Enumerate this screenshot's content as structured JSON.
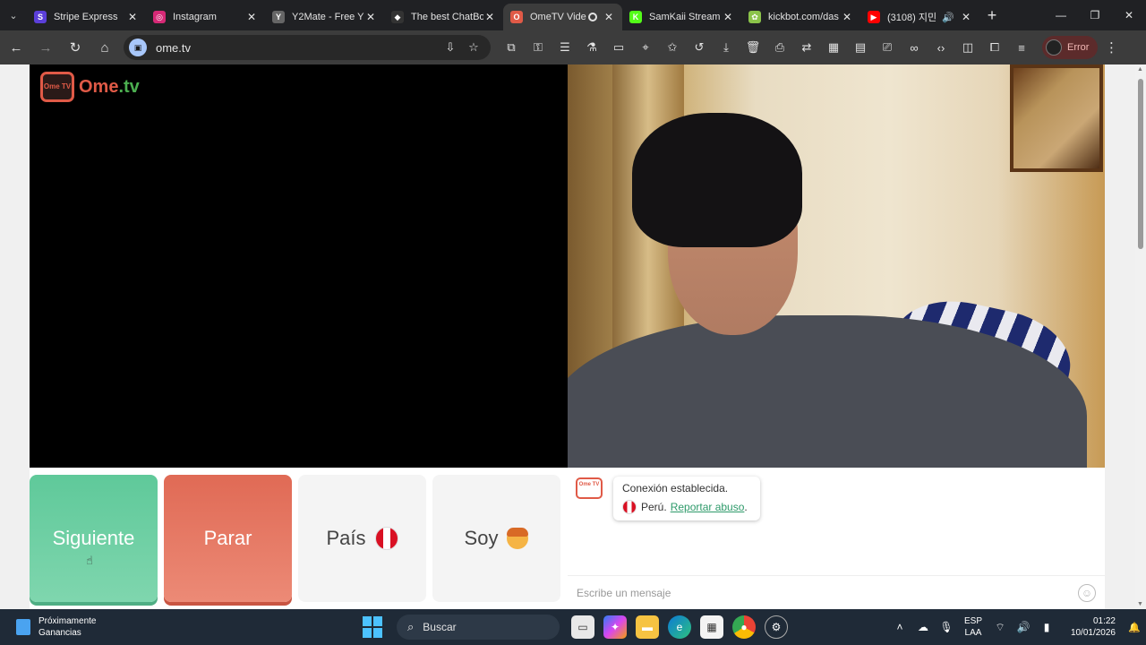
{
  "browser": {
    "tabs": [
      {
        "title": "Stripe Express",
        "fav_color": "#5b3fd9",
        "fav_glyph": "S"
      },
      {
        "title": "Instagram",
        "fav_color": "#d62976",
        "fav_glyph": "◎"
      },
      {
        "title": "Y2Mate - Free Y",
        "fav_color": "#666666",
        "fav_glyph": "Y"
      },
      {
        "title": "The best ChatBo",
        "fav_color": "#333333",
        "fav_glyph": "◆"
      },
      {
        "title": "OmeTV Vide",
        "fav_color": "#e05a47",
        "fav_glyph": "O"
      },
      {
        "title": "SamKaii Stream",
        "fav_color": "#53fc18",
        "fav_glyph": "K"
      },
      {
        "title": "kickbot.com/das",
        "fav_color": "#8bc34a",
        "fav_glyph": "✿"
      },
      {
        "title": "(3108) 지민",
        "fav_color": "#ff0000",
        "fav_glyph": "▶"
      }
    ],
    "active_tab": 4,
    "url": "ome.tv",
    "profile_label": "Error",
    "accent_color": "#e05a47"
  },
  "site": {
    "logo_text": "Ome",
    "logo_tld": ".tv",
    "logo_tv_label": "Ome TV"
  },
  "buttons": {
    "next_label": "Siguiente",
    "stop_label": "Parar",
    "country_label": "País",
    "gender_label": "Soy"
  },
  "chat": {
    "status_line": "Conexión establecida.",
    "country": "Perú.",
    "report_link": "Reportar abuso",
    "report_suffix": ".",
    "input_placeholder": "Escribe un mensaje"
  },
  "taskbar": {
    "widget_title": "Próximamente",
    "widget_subtitle": "Ganancias",
    "search_label": "Buscar",
    "lang_line1": "ESP",
    "lang_line2": "LAA",
    "time": "01:22",
    "date": "10/01/2026"
  }
}
